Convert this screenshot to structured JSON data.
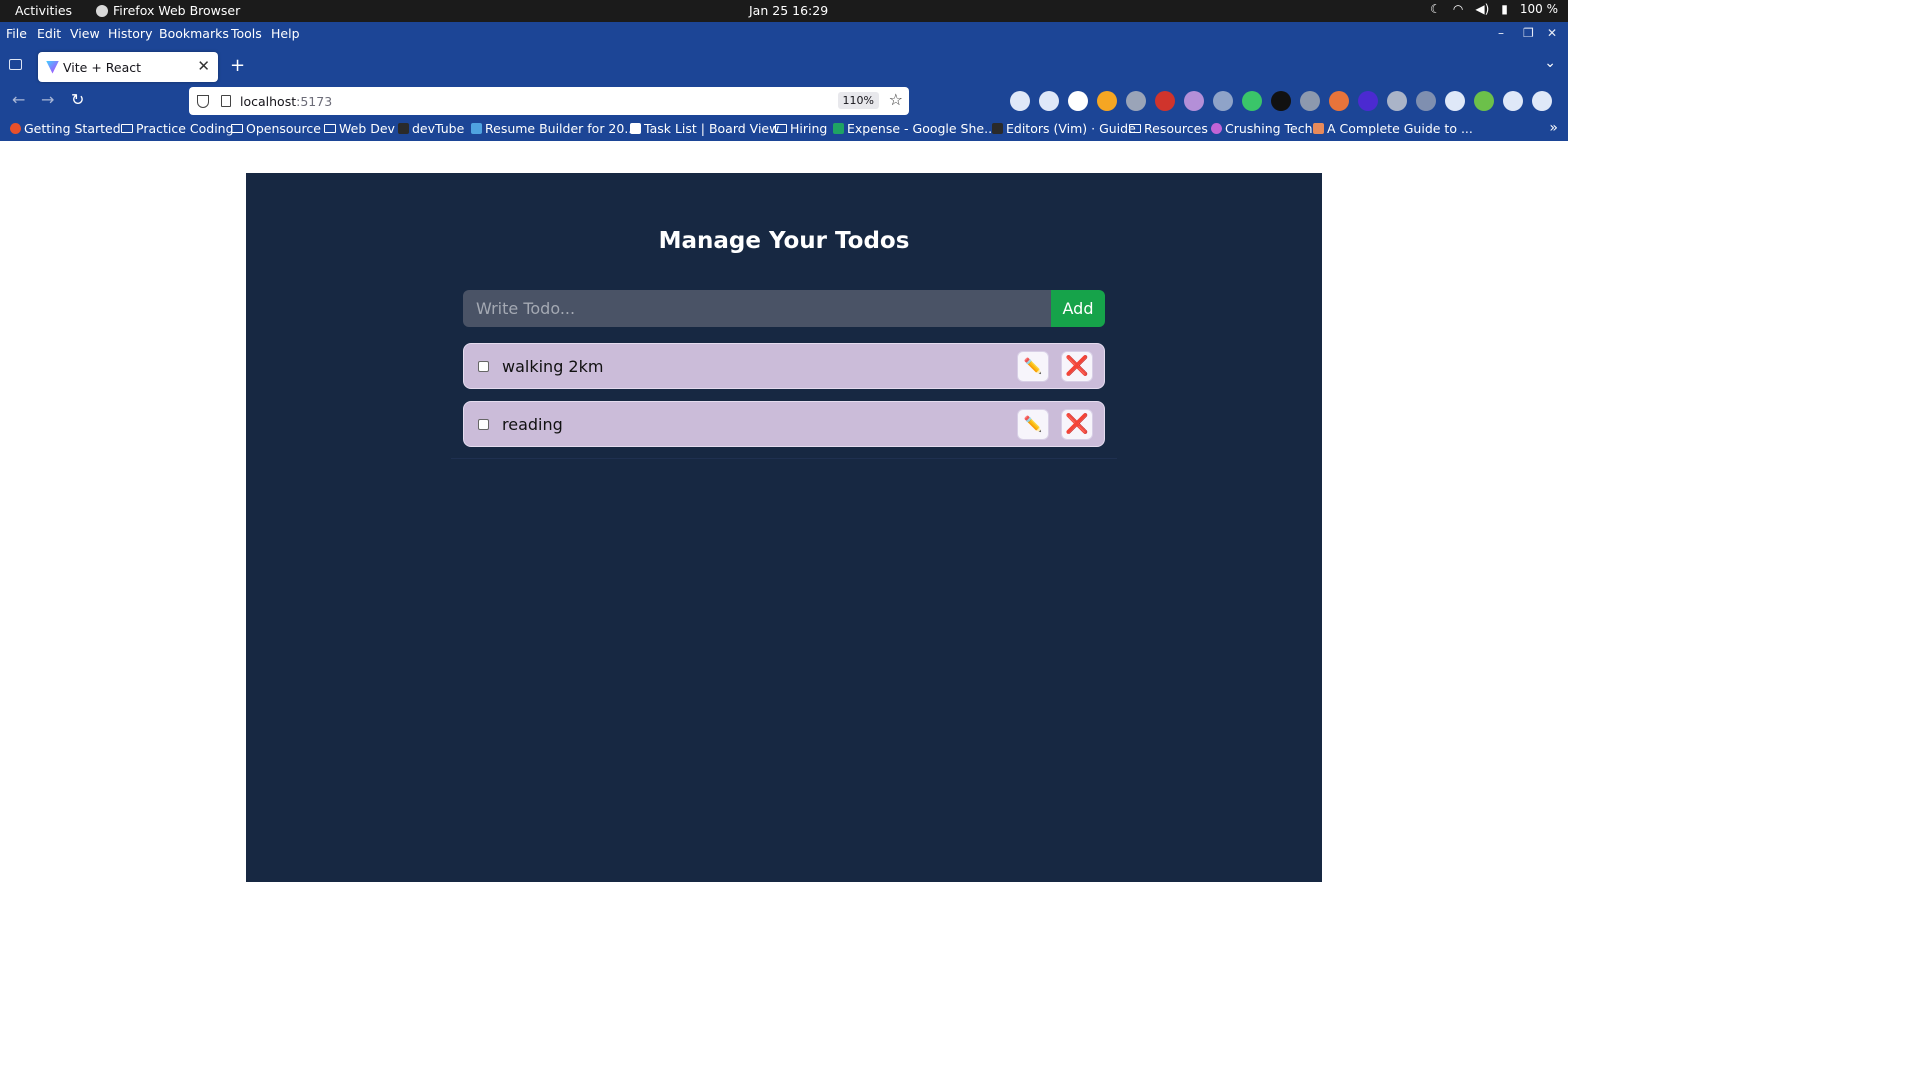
{
  "system_bar": {
    "activities": "Activities",
    "app_name": "Firefox Web Browser",
    "datetime": "Jan 25  16:29",
    "battery": "100 %"
  },
  "menu": [
    "File",
    "Edit",
    "View",
    "History",
    "Bookmarks",
    "Tools",
    "Help"
  ],
  "tab": {
    "title": "Vite + React"
  },
  "address": {
    "host": "localhost",
    "port": ":5173",
    "zoom": "110%"
  },
  "bookmarks": [
    "Getting Started",
    "Practice Coding",
    "Opensource",
    "Web Dev",
    "devTube",
    "Resume Builder for 20...",
    "Task List | Board View",
    "Hiring",
    "Expense - Google She...",
    "Editors (Vim) · Guide",
    "Resources",
    "Crushing Tech",
    "A Complete Guide to ..."
  ],
  "app": {
    "heading": "Manage Your Todos",
    "input_placeholder": "Write Todo...",
    "add_label": "Add",
    "todos": [
      {
        "text": "walking 2km",
        "done": false
      },
      {
        "text": "reading",
        "done": false
      }
    ],
    "edit_icon": "✏️",
    "delete_icon": "❌"
  },
  "colors": {
    "app_bg": "#172842",
    "add_button": "#16a34a",
    "todo_bg": "#cbbcd9",
    "browser_chrome": "#1c4596"
  }
}
